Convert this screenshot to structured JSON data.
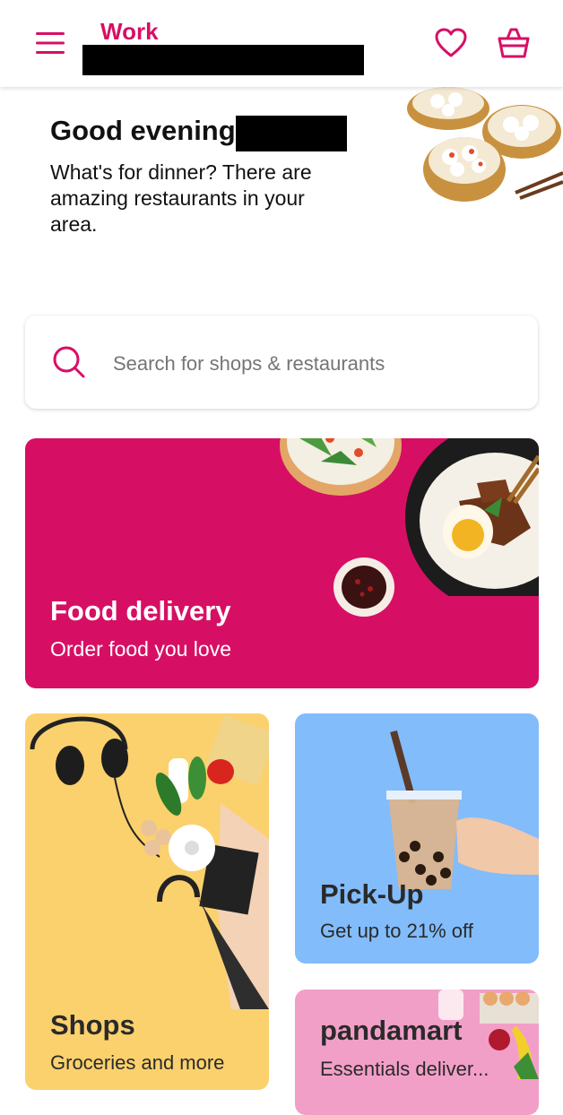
{
  "header": {
    "location_label": "Work",
    "icons": [
      "menu-icon",
      "heart-icon",
      "shopping-bag-icon"
    ]
  },
  "greeting": {
    "title": "Good evening,",
    "subtitle": "What's for dinner? There are amazing restaurants in your area."
  },
  "search": {
    "placeholder": "Search for shops & restaurants"
  },
  "cards": {
    "food_delivery": {
      "title": "Food delivery",
      "subtitle": "Order food you love"
    },
    "shops": {
      "title": "Shops",
      "subtitle": "Groceries and more"
    },
    "pickup": {
      "title": "Pick-Up",
      "subtitle": "Get up to 21% off"
    },
    "pandamart": {
      "title": "pandamart",
      "subtitle": "Essentials deliver..."
    }
  },
  "colors": {
    "brand": "#d70f64",
    "shops_bg": "#fbd16d",
    "pickup_bg": "#82bcfb",
    "pandamart_bg": "#f29fc8"
  }
}
